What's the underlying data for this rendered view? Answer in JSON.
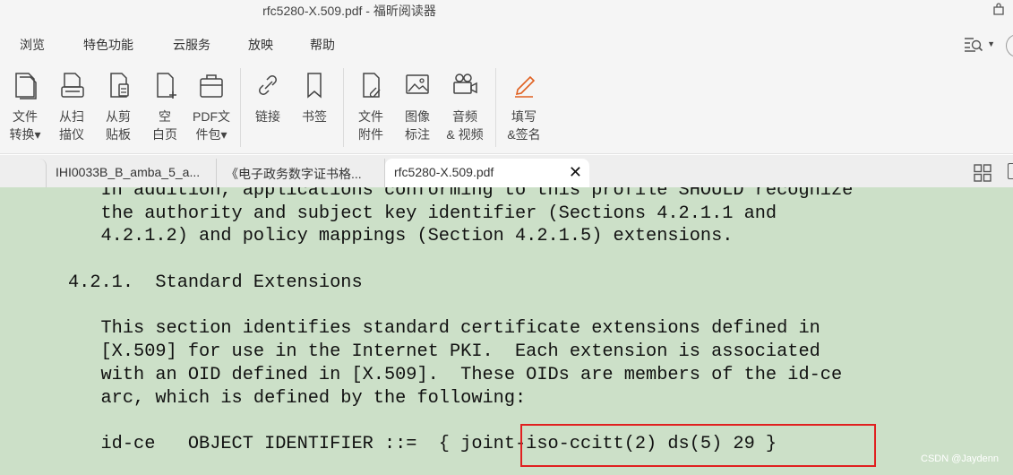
{
  "window": {
    "title": "rfc5280-X.509.pdf - 福昕阅读器"
  },
  "menu": {
    "items": [
      "浏览",
      "特色功能",
      "云服务",
      "放映",
      "帮助"
    ]
  },
  "ribbon": {
    "buttons": [
      {
        "line1": "文件",
        "line2": "转换▾"
      },
      {
        "line1": "从扫",
        "line2": "描仪"
      },
      {
        "line1": "从剪",
        "line2": "贴板"
      },
      {
        "line1": "空",
        "line2": "白页"
      },
      {
        "line1": "PDF文",
        "line2": "件包▾"
      },
      {
        "line1": "链接",
        "line2": ""
      },
      {
        "line1": "书签",
        "line2": ""
      },
      {
        "line1": "文件",
        "line2": "附件"
      },
      {
        "line1": "图像",
        "line2": "标注"
      },
      {
        "line1": "音频",
        "line2": "& 视频"
      },
      {
        "line1": "填写",
        "line2": "&签名"
      }
    ]
  },
  "tabs": [
    {
      "label": "IHI0033B_B_amba_5_a..."
    },
    {
      "label": "《电子政务数字证书格..."
    },
    {
      "label": "rfc5280-X.509.pdf",
      "active": true
    }
  ],
  "document": {
    "lines": [
      "   In addition, applications conforming to this profile SHOULD recognize",
      "   the authority and subject key identifier (Sections 4.2.1.1 and",
      "   4.2.1.2) and policy mappings (Section 4.2.1.5) extensions.",
      "4.2.1.  Standard Extensions",
      "   This section identifies standard certificate extensions defined in",
      "   [X.509] for use in the Internet PKI.  Each extension is associated",
      "   with an OID defined in [X.509].  These OIDs are members of the id-ce",
      "   arc, which is defined by the following:",
      "   id-ce   OBJECT IDENTIFIER ::=  { joint-iso-ccitt(2) ds(5) 29 }"
    ]
  },
  "watermark": "CSDN @Jaydenn",
  "colors": {
    "doc_background": "#cce0c8",
    "highlight_box": "#e02020",
    "chrome": "#f5f5f5"
  }
}
